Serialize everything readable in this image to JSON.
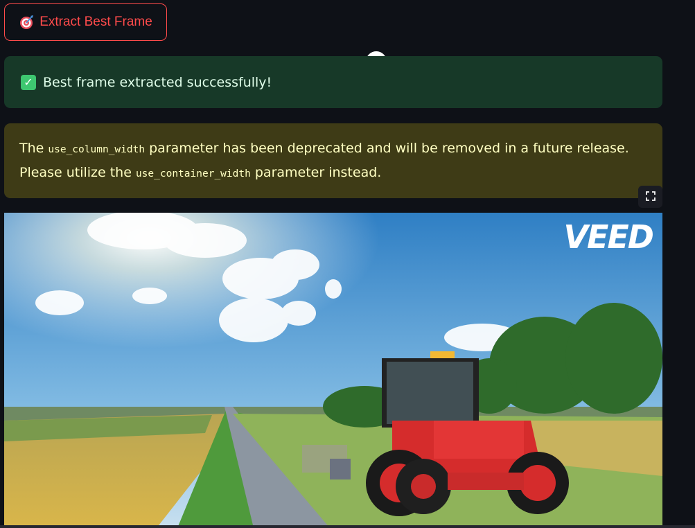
{
  "extract_button": {
    "label": "Extract Best Frame",
    "icon": "target-dart-icon"
  },
  "success_alert": {
    "icon": "check-mark-icon",
    "message": "Best frame extracted successfully!"
  },
  "warning_alert": {
    "text_1": "The ",
    "code_1": "use_column_width",
    "text_2": " parameter has been deprecated and will be removed in a future release. Please utilize the ",
    "code_2": "use_container_width",
    "text_3": " parameter instead."
  },
  "fullscreen_button": {
    "icon": "fullscreen-icon"
  },
  "frame_image": {
    "watermark": "VEED",
    "subject": "red tractor on country road"
  },
  "colors": {
    "accent": "#ff4b4b",
    "success_bg": "#173928",
    "warning_bg": "#3e3b16",
    "page_bg": "#0e1117"
  }
}
